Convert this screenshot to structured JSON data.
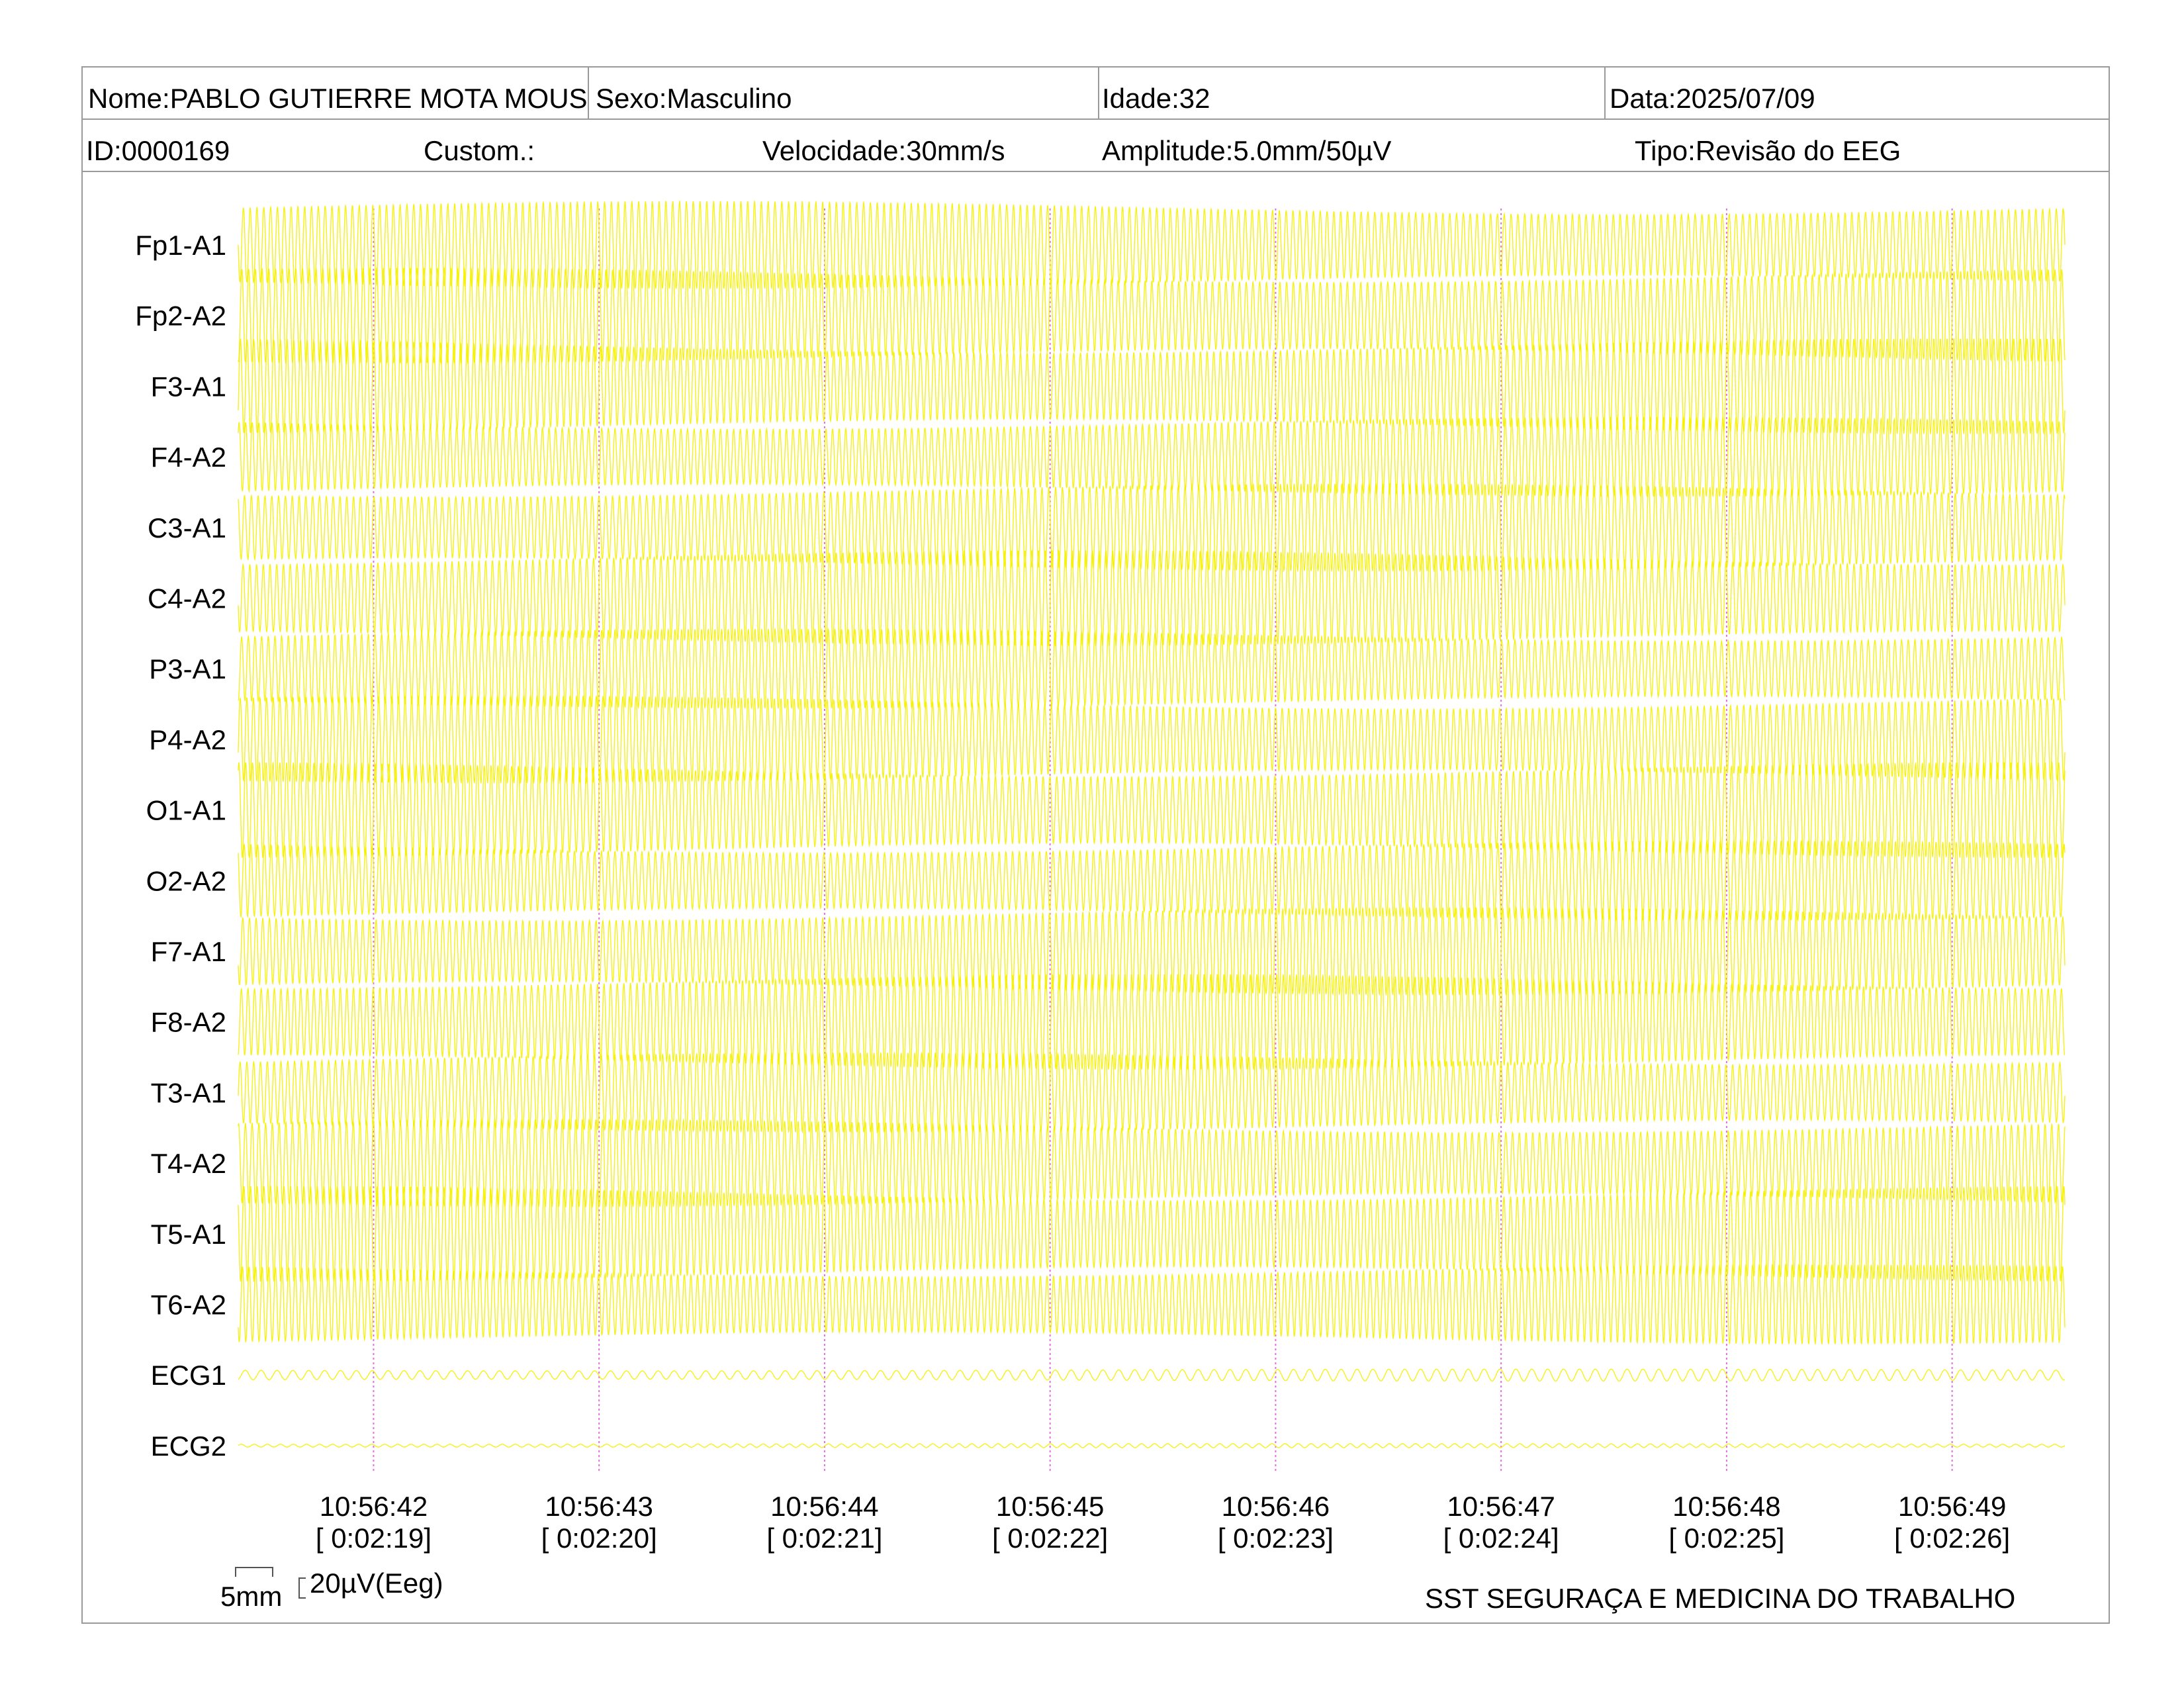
{
  "header": {
    "name": "Nome:PABLO GUTIERRE MOTA MOUS",
    "sex": "Sexo:Masculino",
    "age": "Idade:32",
    "date": "Data:2025/07/09",
    "id": "ID:0000169",
    "custom": "Custom.:",
    "speed": "Velocidade:30mm/s",
    "amplitude": "Amplitude:5.0mm/50µV",
    "type": "Tipo:Revisão do EEG"
  },
  "chart_data": {
    "type": "line",
    "channels": [
      "Fp1-A1",
      "Fp2-A2",
      "F3-A1",
      "F4-A2",
      "C3-A1",
      "C4-A2",
      "P3-A1",
      "P4-A2",
      "O1-A1",
      "O2-A2",
      "F7-A1",
      "F8-A2",
      "T3-A1",
      "T4-A2",
      "T5-A1",
      "T6-A2",
      "ECG1",
      "ECG2"
    ],
    "time_ticks": [
      "10:56:42",
      "10:56:43",
      "10:56:44",
      "10:56:45",
      "10:56:46",
      "10:56:47",
      "10:56:48",
      "10:56:49"
    ],
    "elapsed_ticks": [
      "[ 0:02:19]",
      "[ 0:02:20]",
      "[ 0:02:21]",
      "[ 0:02:22]",
      "[ 0:02:23]",
      "[ 0:02:24]",
      "[ 0:02:25]",
      "[ 0:02:26]"
    ],
    "trace_color": "#f5f000",
    "marker_color": "#e070e0",
    "xlim_seconds": [
      -0.6,
      7.5
    ]
  },
  "scale": {
    "time_label": "5mm",
    "amp_label": "20µV(Eeg)"
  },
  "footer": {
    "company": "SST SEGURAÇA E MEDICINA DO TRABALHO"
  }
}
